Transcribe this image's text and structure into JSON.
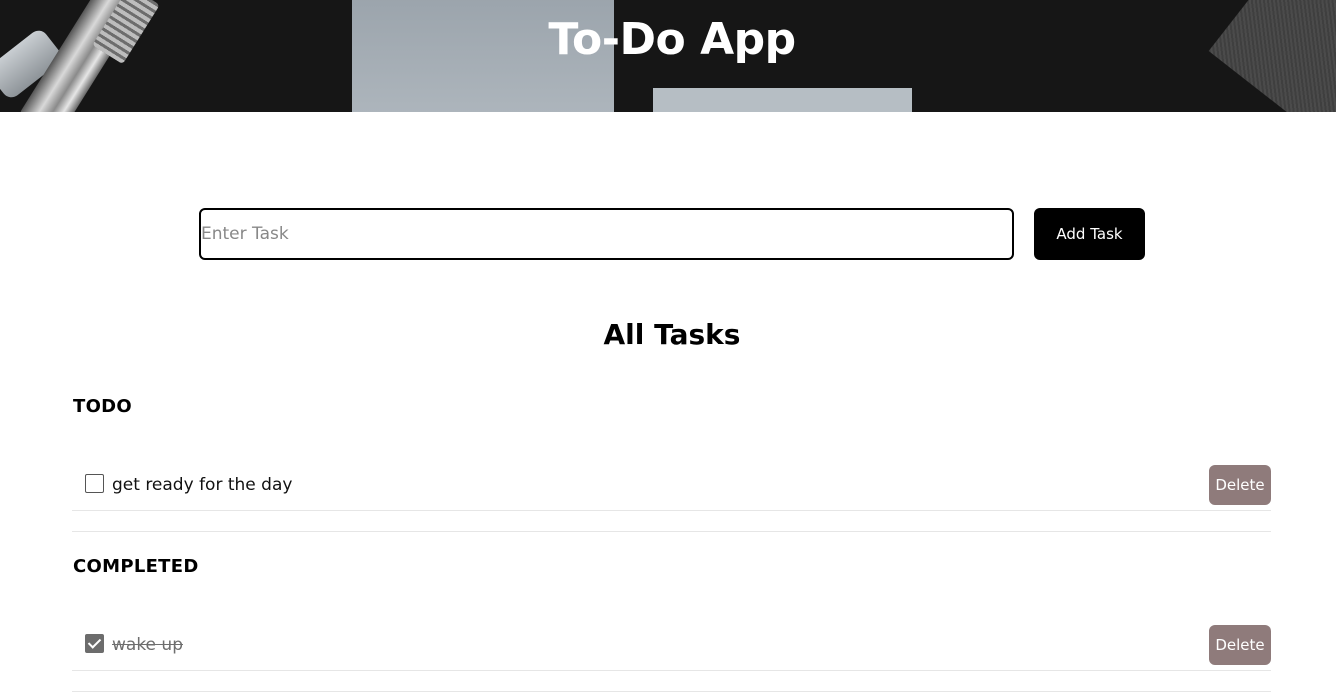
{
  "app": {
    "title": "To-Do App"
  },
  "add_task": {
    "input_placeholder": "Enter Task",
    "input_value": "",
    "button_label": "Add Task"
  },
  "list": {
    "heading": "All Tasks",
    "todo": {
      "title": "TODO",
      "items": [
        {
          "label": "get ready for the day",
          "checked": false,
          "delete_label": "Delete"
        }
      ]
    },
    "completed": {
      "title": "COMPLETED",
      "items": [
        {
          "label": "wake up",
          "checked": true,
          "delete_label": "Delete"
        }
      ]
    }
  },
  "colors": {
    "primary_button": "#000000",
    "delete_button": "#8f7b7b",
    "completed_text": "#6e6e6e"
  }
}
